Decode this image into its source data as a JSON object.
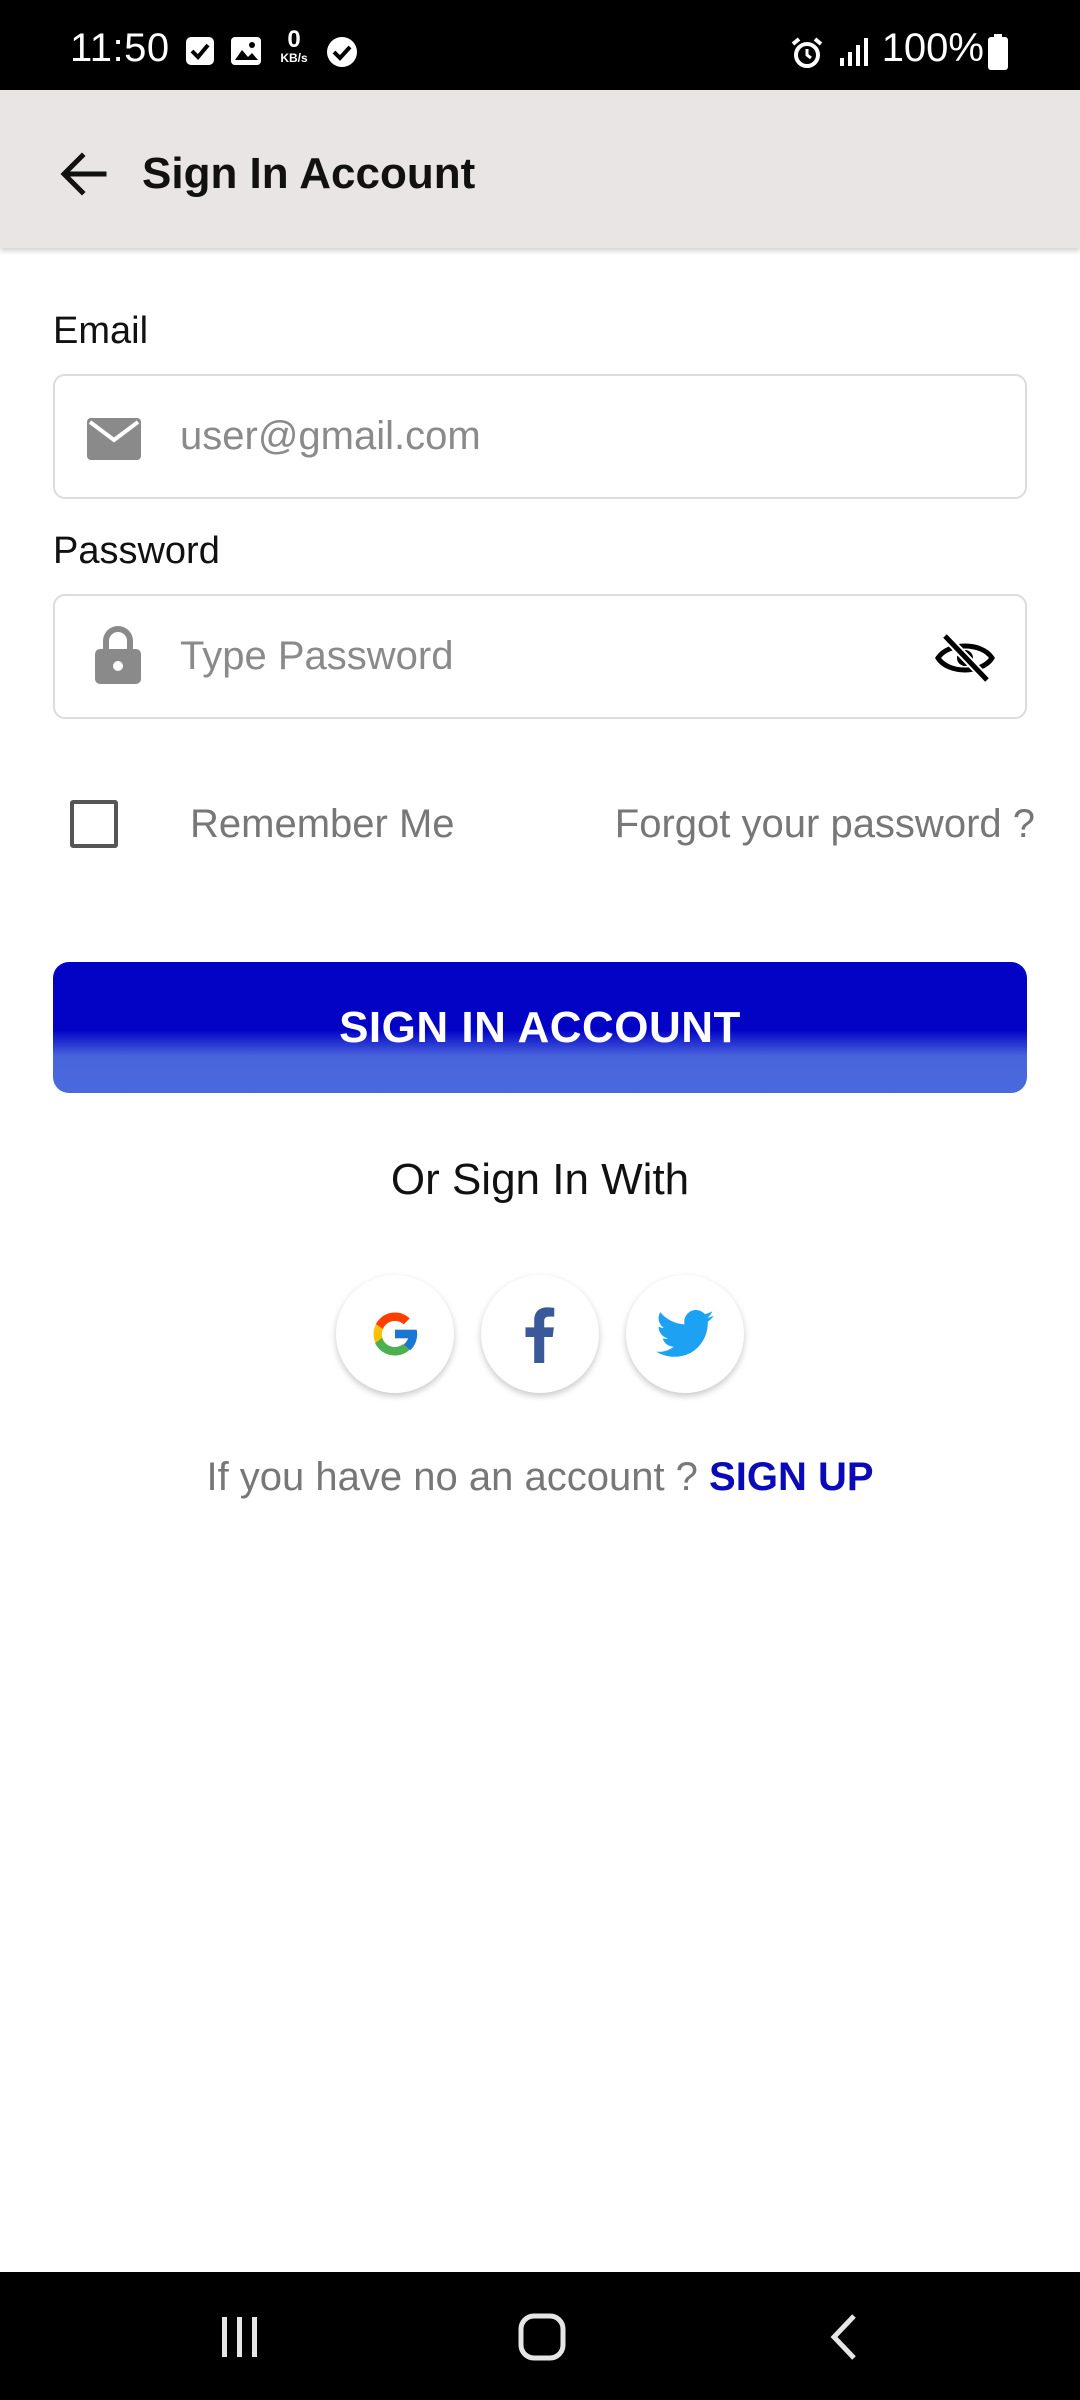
{
  "status_bar": {
    "time": "11:50",
    "kb_value": "0",
    "kb_unit": "KB/s",
    "battery": "100%"
  },
  "app_bar": {
    "title": "Sign In Account"
  },
  "form": {
    "email_label": "Email",
    "email_placeholder": "user@gmail.com",
    "password_label": "Password",
    "password_placeholder": "Type Password",
    "remember_label": "Remember Me",
    "remember_checked": false,
    "forgot_link": "Forgot your password ?",
    "submit_label": "SIGN IN ACCOUNT"
  },
  "social": {
    "heading": "Or Sign In With",
    "providers": [
      "google-icon",
      "facebook-icon",
      "twitter-icon"
    ]
  },
  "signup": {
    "prompt": "If you have no an account ?",
    "link": "SIGN UP"
  },
  "colors": {
    "primary": "#0303c6",
    "primary_light": "#4a69dd",
    "link": "#0a0ab8",
    "app_bar_bg": "#e9e5e4"
  }
}
